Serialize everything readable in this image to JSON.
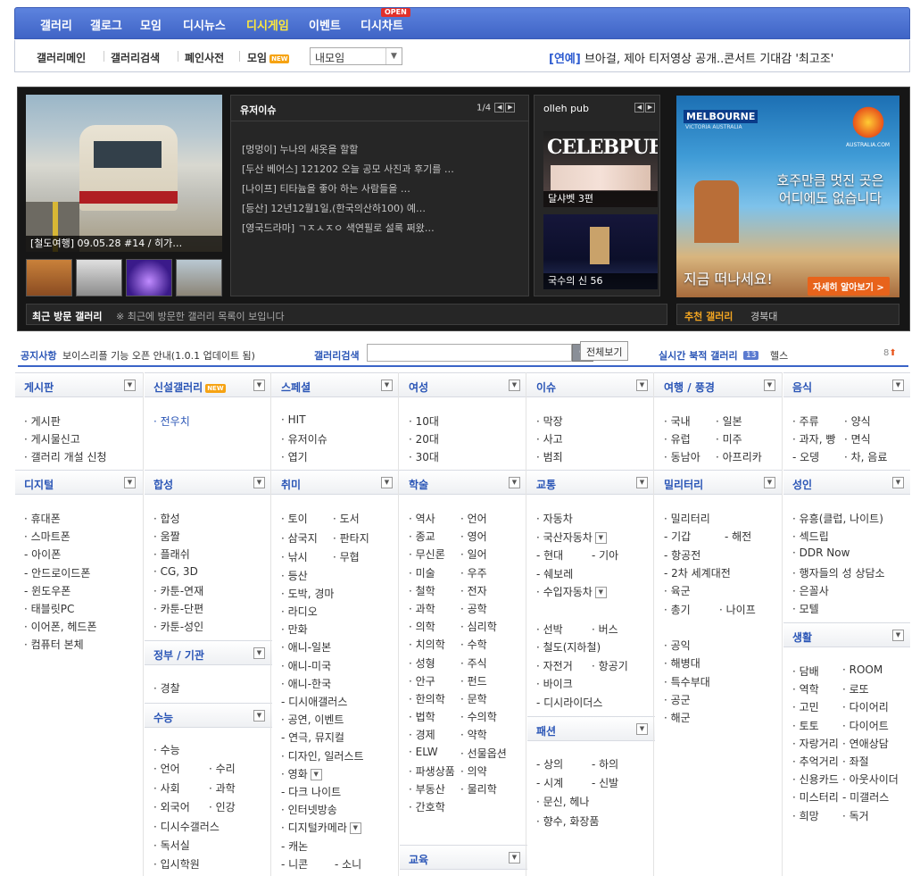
{
  "topnav": {
    "items": [
      "갤러리",
      "갤로그",
      "모임",
      "디시뉴스",
      "디시게임",
      "이벤트",
      "디시차트"
    ],
    "open_badge": "OPEN"
  },
  "subnav": {
    "items": [
      "갤러리메인",
      "갤러리검색",
      "폐인사전",
      "모임"
    ],
    "new_badge": "NEW",
    "my_select": "내모임",
    "hot_tag": "[연예]",
    "hot_text": "브아걸, 제아 티저영상 공개..콘서트 기대감 '최고조'"
  },
  "feature": {
    "caption": "[철도여행] 09.05.28 #14 / 히가…"
  },
  "issues": {
    "title": "유저이슈",
    "page": "1/4",
    "list": [
      "[멍멍이] 누나의 새옷을 할할",
      "[두산 베어스] 121202 오늘 공모 사진과 후기를 …",
      "[나이프] 티타늄을 좋아 하는 사람들을 …",
      "[등산] 12년12월1일,(한국의산하100) 예…",
      "[영국드라마] ㄱㅈㅅㅈㅇ 색연필로 설록 쩌왔…"
    ]
  },
  "pub": {
    "title": "olleh pub",
    "logo": "CELEBPUB",
    "cap1": "달샤벳 3편",
    "cap2": "국수의 신 56"
  },
  "ad": {
    "brand": "MELBOURNE",
    "brand_sub": "VICTORIA AUSTRALIA",
    "site": "AUSTRALIA.COM",
    "line1": "호주만큼 멋진 곳은",
    "line2": "어디에도 없습니다",
    "line3": "지금 떠나세요!",
    "btn": "자세히 알아보기 >"
  },
  "recent": {
    "label": "최근 방문 갤러리",
    "text": "※ 최근에 방문한 갤러리 목록이 보입니다"
  },
  "recommend": {
    "label": "추천 갤러리",
    "value": "경북대"
  },
  "notice": {
    "label": "공지사항",
    "text": "보이스리플 기능 오픈 안내(1.0.1 업데이트 됨)",
    "search_label": "갤러리검색",
    "allview": "전체보기",
    "realtime_label": "실시간 북적 갤러리",
    "realtime_num": "13",
    "realtime_value": "헬스",
    "rank": "8"
  },
  "cats": [
    {
      "title": "게시판",
      "items": [
        "게시판",
        "게시물신고",
        "갤러리 개설 신청"
      ]
    },
    {
      "title": "신설갤러리",
      "items": [
        "전우치"
      ]
    },
    {
      "title": "스페셜",
      "items": [
        "HIT",
        "유저이슈",
        "엽기"
      ]
    },
    {
      "title": "여성",
      "items": [
        "10대",
        "20대",
        "30대"
      ]
    },
    {
      "title": "이슈",
      "items": [
        "막장",
        "사고",
        "범죄"
      ]
    },
    {
      "title": "여행 / 풍경",
      "items": [
        "국내",
        "일본",
        "유럽",
        "미주",
        "동남아",
        "아프리카"
      ]
    },
    {
      "title": "음식",
      "items": [
        "주류",
        "양식",
        "과자, 빵",
        "면식",
        "- 오뎅",
        "차, 음료"
      ]
    },
    {
      "title": "디지털",
      "items": [
        "휴대폰",
        "스마트폰",
        "- 아이폰",
        "- 안드로이드폰",
        "- 윈도우폰",
        "태블릿PC",
        "이어폰, 헤드폰",
        "컴퓨터 본체"
      ]
    },
    {
      "title": "합성",
      "items": [
        "합성",
        "움짤",
        "플래쉬",
        "CG, 3D",
        "카툰-연재",
        "카툰-단편",
        "카툰-성인"
      ]
    },
    {
      "title": "취미",
      "items": [
        "토이",
        "도서",
        "삼국지",
        "판타지",
        "낚시",
        "무협",
        "등산",
        "도박, 경마",
        "라디오",
        "만화",
        "애니-일본",
        "애니-미국",
        "애니-한국",
        "- 디시애갤러스",
        "공연, 이벤트",
        "- 연극, 뮤지컬",
        "디자인, 일러스트",
        "영화",
        "- 다크 나이트",
        "인터넷방송",
        "디지털카메라",
        "- 캐논",
        "- 니콘",
        "- 소니"
      ]
    },
    {
      "title": "학술",
      "items": [
        "역사",
        "언어",
        "종교",
        "영어",
        "무신론",
        "일어",
        "미술",
        "우주",
        "철학",
        "전자",
        "과학",
        "공학",
        "의학",
        "심리학",
        "치의학",
        "수학",
        "성형",
        "주식",
        "안구",
        "펀드",
        "한의학",
        "문학",
        "법학",
        "수의학",
        "경제",
        "약학",
        "ELW",
        "선물옵션",
        "파생상품",
        "의약",
        "부동산",
        "물리학",
        "간호학"
      ]
    },
    {
      "title": "교통",
      "items": [
        "자동차",
        "국산자동차",
        "- 현대",
        "- 기아",
        "- 쉐보레",
        "수입자동차",
        "선박",
        "버스",
        "철도(지하철)",
        "자전거",
        "항공기",
        "바이크",
        "- 디시라이더스"
      ]
    },
    {
      "title": "밀리터리",
      "items": [
        "밀리터리",
        "- 기갑",
        "- 해전",
        "- 항공전",
        "- 2차 세계대전",
        "육군",
        "총기",
        "나이프",
        "공익",
        "해병대",
        "특수부대",
        "공군",
        "해군"
      ]
    },
    {
      "title": "성인",
      "items": [
        "유흥(클럽, 나이트)",
        "섹드립",
        "DDR Now",
        "행자들의 성 상담소",
        "은꼴사",
        "모텔"
      ]
    },
    {
      "title": "정부 / 기관",
      "items": [
        "경찰"
      ]
    },
    {
      "title": "수능",
      "items": [
        "수능",
        "언어",
        "수리",
        "사회",
        "과학",
        "외국어",
        "인강",
        "디시수갤러스",
        "독서실",
        "입시학원"
      ]
    },
    {
      "title": "패션",
      "items": [
        "- 상의",
        "- 하의",
        "- 시계",
        "- 신발",
        "문신, 헤나",
        "향수, 화장품"
      ]
    },
    {
      "title": "생활",
      "items": [
        "담배",
        "ROOM",
        "역학",
        "로또",
        "고민",
        "다이어리",
        "토토",
        "다이어트",
        "자랑거리",
        "연애상담",
        "추억거리",
        "좌절",
        "신용카드",
        "아웃사이더",
        "미스터리",
        "- 미갤러스",
        "희망",
        "독거"
      ]
    },
    {
      "title": "교육",
      "items": []
    }
  ]
}
